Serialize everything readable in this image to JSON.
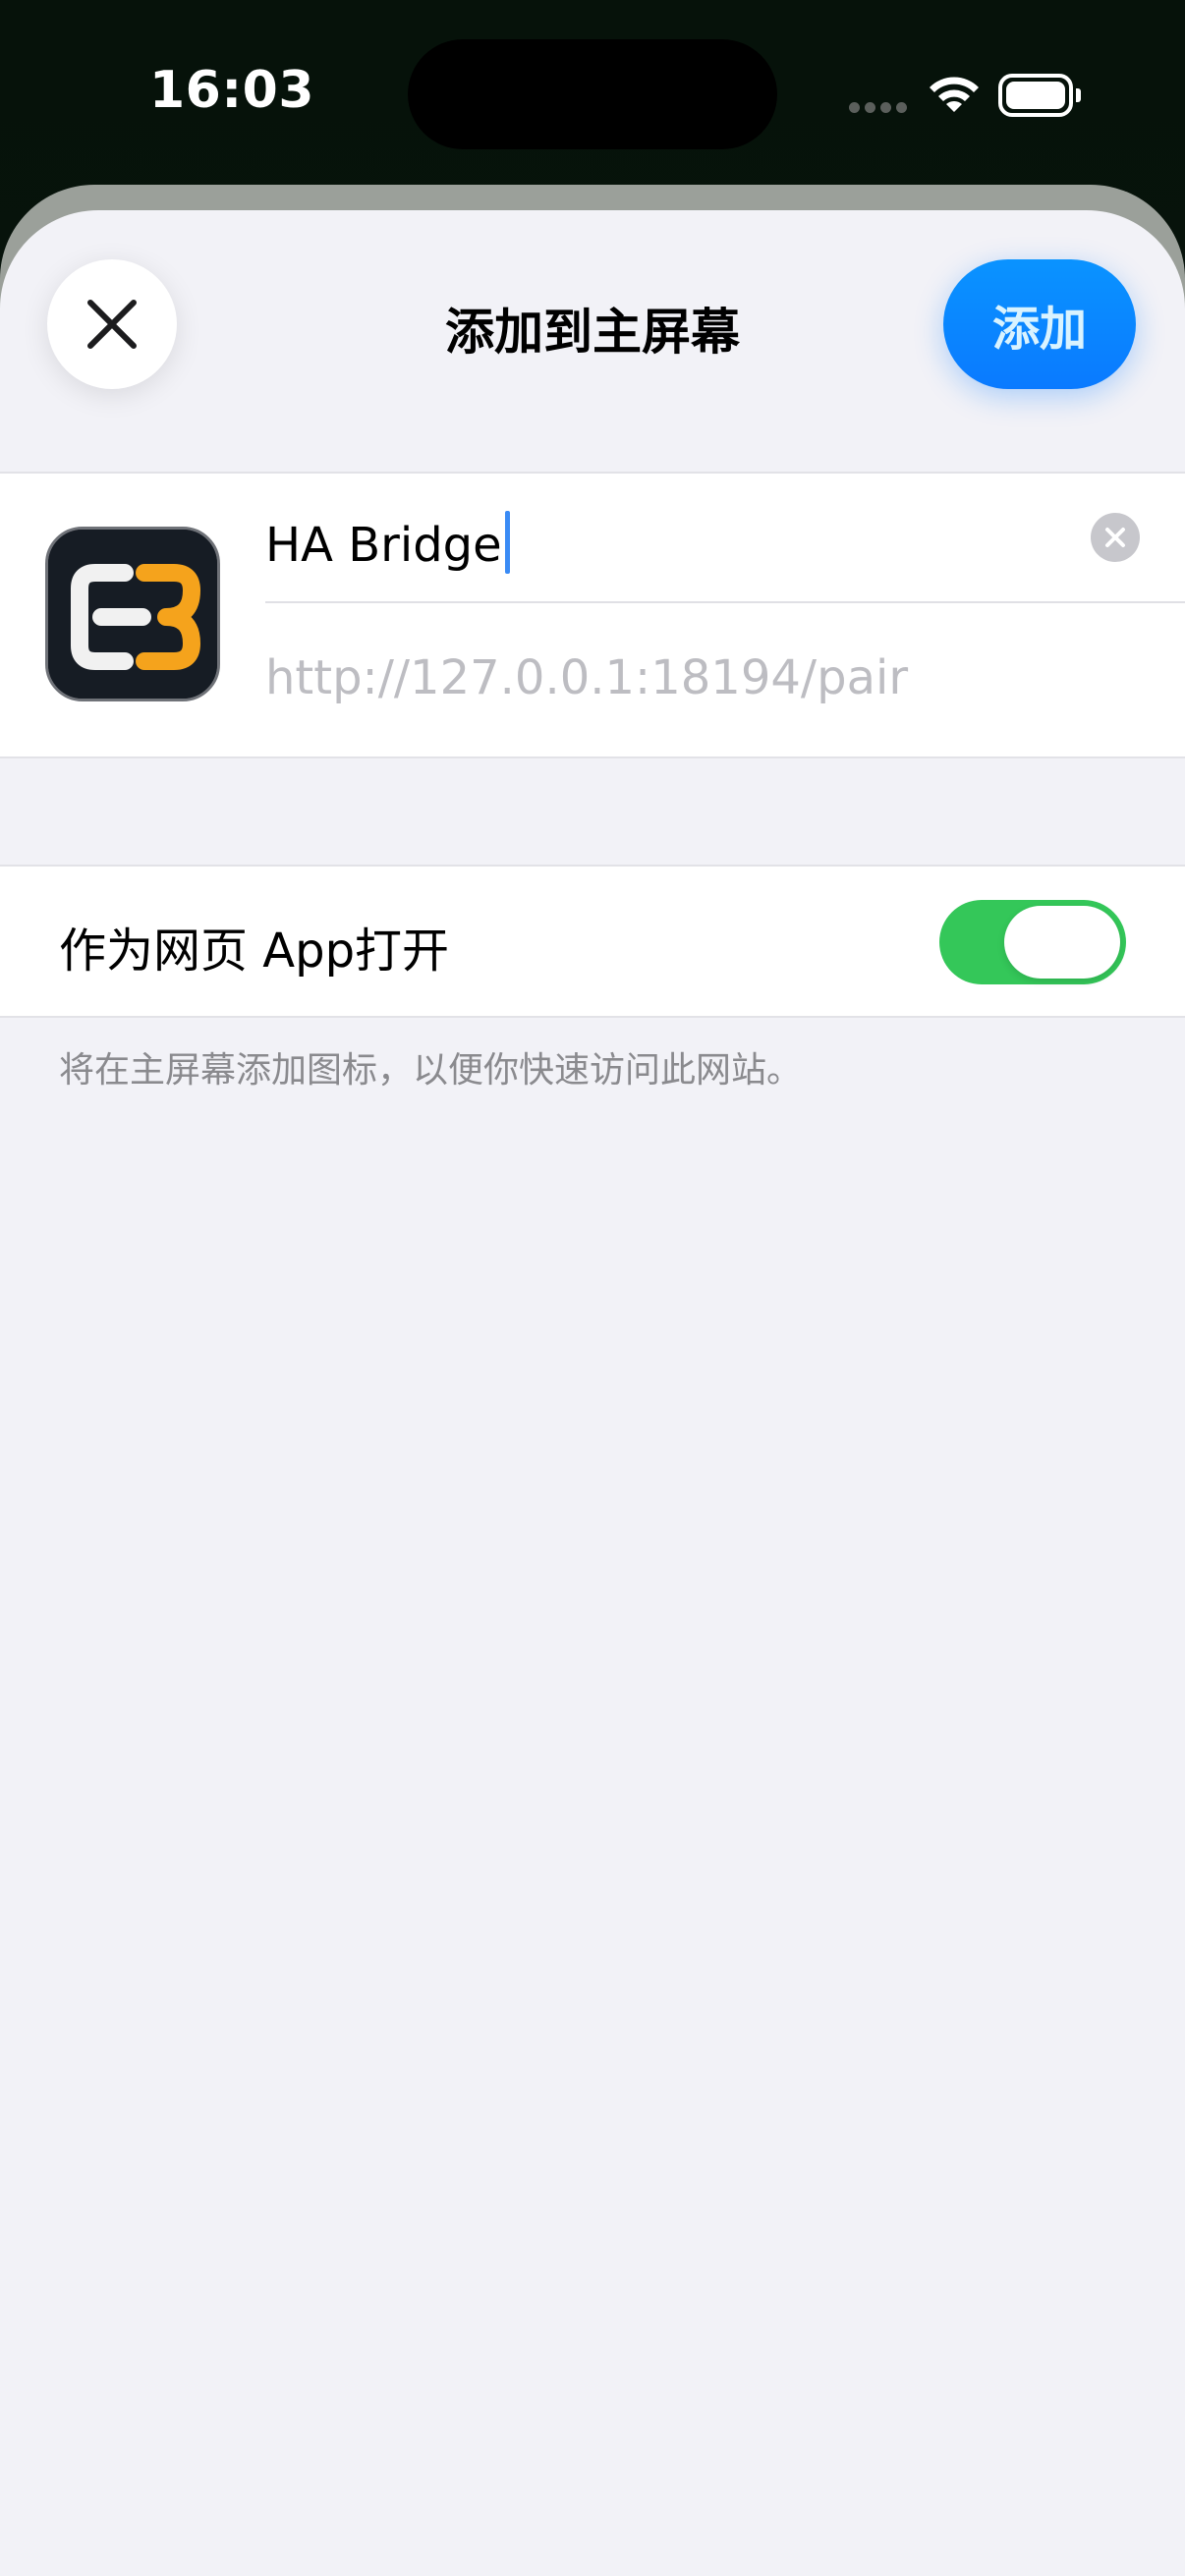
{
  "status_bar": {
    "time": "16:03"
  },
  "sheet": {
    "title": "添加到主屏幕",
    "close_icon": "close-icon",
    "add_label": "添加"
  },
  "bookmark": {
    "icon": "c3-app-icon",
    "name_value": "HA Bridge",
    "clear_icon": "clear-circle-icon",
    "url": "http://127.0.0.1:18194/pair"
  },
  "web_app_option": {
    "label": "作为网页 App打开",
    "enabled": true
  },
  "footer": {
    "note": "将在主屏幕添加图标，以便你快速访问此网站。"
  },
  "colors": {
    "accent": "#0a84ff",
    "toggle_on": "#34c759",
    "background": "#f2f2f7"
  }
}
